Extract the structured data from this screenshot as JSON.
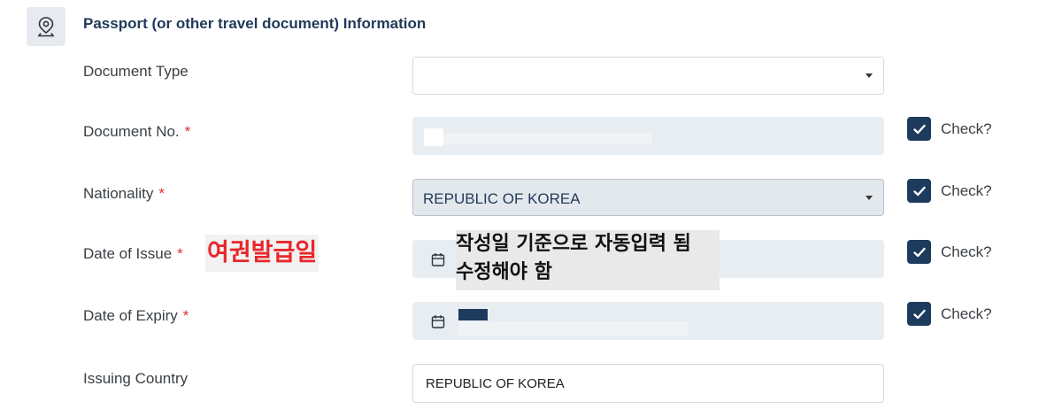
{
  "section": {
    "title": "Passport (or other travel document) Information",
    "icon": "map-pin-icon"
  },
  "fields": {
    "document_type": {
      "label": "Document Type",
      "value": ""
    },
    "document_no": {
      "label": "Document No.",
      "required": "*",
      "value": "",
      "check_label": "Check?"
    },
    "nationality": {
      "label": "Nationality",
      "required": "*",
      "value": "REPUBLIC OF KOREA",
      "check_label": "Check?"
    },
    "date_of_issue": {
      "label": "Date of Issue",
      "required": "*",
      "value": "",
      "check_label": "Check?"
    },
    "date_of_expiry": {
      "label": "Date of Expiry",
      "required": "*",
      "value": "",
      "check_label": "Check?"
    },
    "issuing_country": {
      "label": "Issuing Country",
      "value": "REPUBLIC OF KOREA"
    }
  },
  "annotations": {
    "issue_date_note": "여권발급일",
    "auto_input_note_line1": "작성일 기준으로 자동입력 됨",
    "auto_input_note_line2": "수정해야 함"
  },
  "colors": {
    "accent": "#1d3b5c",
    "required": "#d9302e",
    "annotation_red": "#e8262a"
  }
}
